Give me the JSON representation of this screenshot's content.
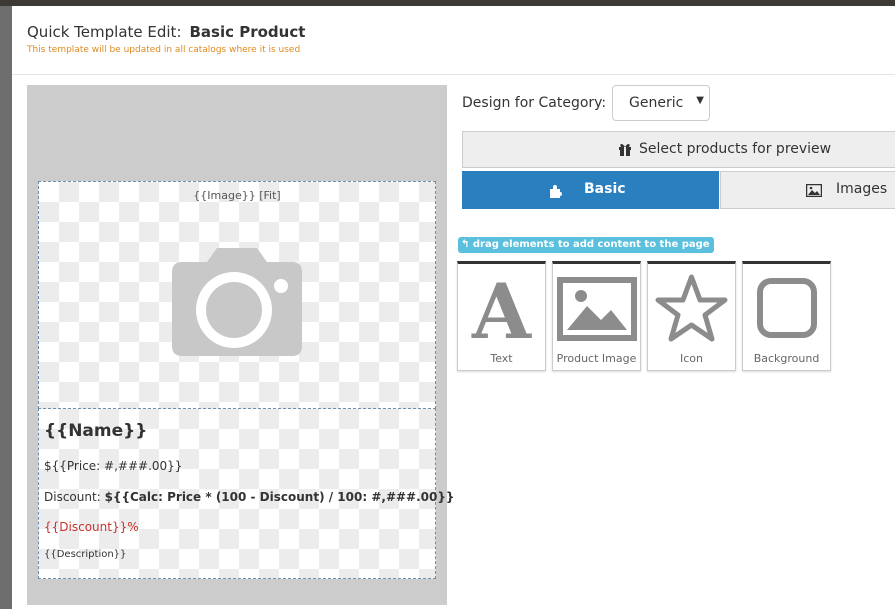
{
  "header": {
    "title_prefix": "Quick Template Edit:",
    "title_name": "Basic Product",
    "subtitle": "This template will be updated in all catalogs where it is used"
  },
  "preview": {
    "image_label": "{{Image}} [Fit]",
    "name": "{{Name}}",
    "price": "${{Price: #,###.00}}",
    "discount_label": "Discount:",
    "discount_calc": "${{Calc: Price * (100 - Discount) / 100: #,###.00}}",
    "discount_pct": "{{Discount}}%",
    "description": "{{Description}}"
  },
  "panel": {
    "category_label": "Design for Category:",
    "category_value": "Generic",
    "preview_button": "Select products for preview",
    "tabs": [
      {
        "label": "Basic",
        "active": true,
        "icon": "puzzle-icon"
      },
      {
        "label": "Images",
        "active": false,
        "icon": "image-icon"
      }
    ],
    "drag_hint": "drag elements to add content to the page",
    "elements": [
      {
        "label": "Text",
        "icon": "letter-a-icon"
      },
      {
        "label": "Product Image",
        "icon": "image-icon"
      },
      {
        "label": "Icon",
        "icon": "star-icon"
      },
      {
        "label": "Background",
        "icon": "rounded-square-icon"
      }
    ]
  },
  "colors": {
    "accent": "#2a7fbf",
    "hint": "#5bc0de",
    "warning_text": "#e08a1e",
    "discount_text": "#c9302c"
  }
}
